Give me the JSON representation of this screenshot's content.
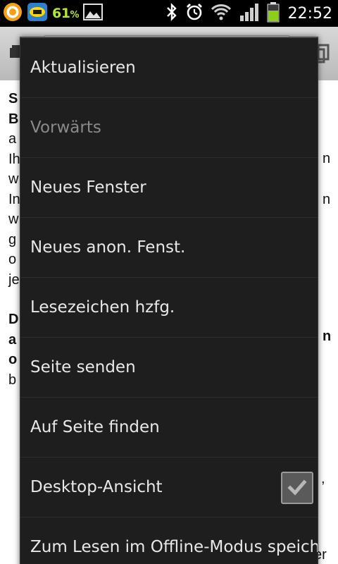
{
  "status_bar": {
    "battery_percent": "61",
    "battery_percent_sign": "%",
    "clock": "22:52",
    "icons": [
      "notification-app-icon",
      "notification-app2-icon",
      "image-notification-icon",
      "bluetooth-icon",
      "alarm-icon",
      "wifi-icon",
      "signal-icon",
      "battery-icon"
    ]
  },
  "page": {
    "lines": [
      {
        "text": "S",
        "bold": true
      },
      {
        "text": "B",
        "bold": true
      },
      {
        "text": "a",
        "bold": false
      },
      {
        "text": "Ih",
        "bold": false
      },
      {
        "text": "w",
        "bold": false
      },
      {
        "text": "In",
        "bold": false
      },
      {
        "text": "w",
        "bold": false
      },
      {
        "text": "g",
        "bold": false
      },
      {
        "text": "o",
        "bold": false
      },
      {
        "text": "je",
        "bold": false
      }
    ],
    "lines2": [
      {
        "text": "D",
        "bold": true
      },
      {
        "text": "a",
        "bold": true
      },
      {
        "text": "o",
        "bold": true
      },
      {
        "text": "b",
        "bold": false
      }
    ],
    "right_fragments": {
      "f1": "n",
      "f2": "n",
      "f3": "n",
      "f4": ",",
      "f5": "er"
    }
  },
  "menu": {
    "items": [
      {
        "label": "Aktualisieren",
        "enabled": true
      },
      {
        "label": "Vorwärts",
        "enabled": false
      },
      {
        "label": "Neues Fenster",
        "enabled": true
      },
      {
        "label": "Neues anon. Fenst.",
        "enabled": true
      },
      {
        "label": "Lesezeichen hzfg.",
        "enabled": true
      },
      {
        "label": "Seite senden",
        "enabled": true
      },
      {
        "label": "Auf Seite finden",
        "enabled": true
      },
      {
        "label": "Desktop-Ansicht",
        "enabled": true,
        "checked": true
      },
      {
        "label": "Zum Lesen im Offline-Modus speichern",
        "enabled": true
      }
    ]
  },
  "colors": {
    "menu_bg": "#1e1e1e",
    "menu_text": "#e8e8e8",
    "disabled_text": "#8a8a8a",
    "battery_green": "#b6e53a"
  }
}
